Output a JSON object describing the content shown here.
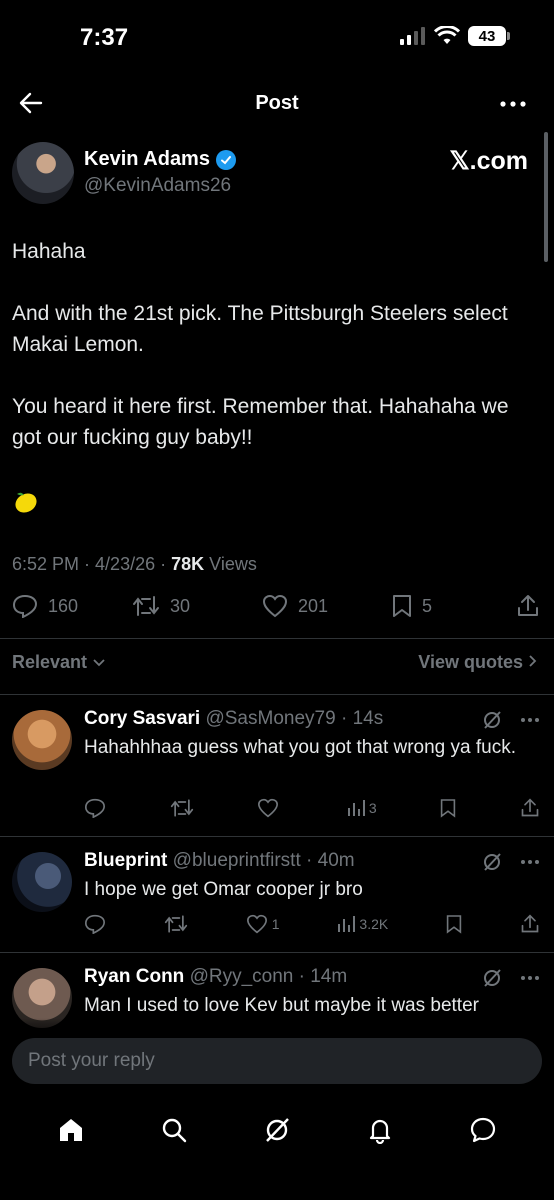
{
  "status": {
    "time": "7:37",
    "battery": "43"
  },
  "nav": {
    "title": "Post"
  },
  "post": {
    "author_name": "Kevin Adams",
    "author_handle": "@KevinAdams26",
    "source": "𝕏.com",
    "paragraphs": [
      "Hahaha",
      "And with the 21st pick. The Pittsburgh Steelers select Makai Lemon.",
      "You heard it here first. Remember that. Hahahaha we got our fucking guy baby!!"
    ],
    "emoji": "🍋",
    "time": "6:52 PM",
    "date": "4/23/26",
    "views_count": "78K",
    "views_label": "Views",
    "replies": "160",
    "reposts": "30",
    "likes": "201",
    "bookmarks": "5"
  },
  "filter": {
    "relevant": "Relevant",
    "view_quotes": "View quotes"
  },
  "replies": [
    {
      "name": "Cory Sasvari",
      "handle": "@SasMoney79",
      "time": "14s",
      "text": "Hahahhhaa guess what you got that wrong ya fuck.",
      "likes": "",
      "views": "3"
    },
    {
      "name": "Blueprint",
      "handle": "@blueprintfirstt",
      "time": "40m",
      "text": "I hope we get Omar cooper jr bro",
      "likes": "1",
      "views": "3.2K"
    },
    {
      "name": "Ryan Conn",
      "handle": "@Ryy_conn",
      "time": "14m",
      "text": "Man I used to love Kev but maybe it was better",
      "likes": "",
      "views": ""
    }
  ],
  "compose": {
    "placeholder": "Post your reply"
  },
  "colors": {
    "background": "#000000",
    "text": "#e7e9ea",
    "secondary": "#71767b",
    "accent": "#1d9bf0",
    "divider": "#2f3336"
  }
}
